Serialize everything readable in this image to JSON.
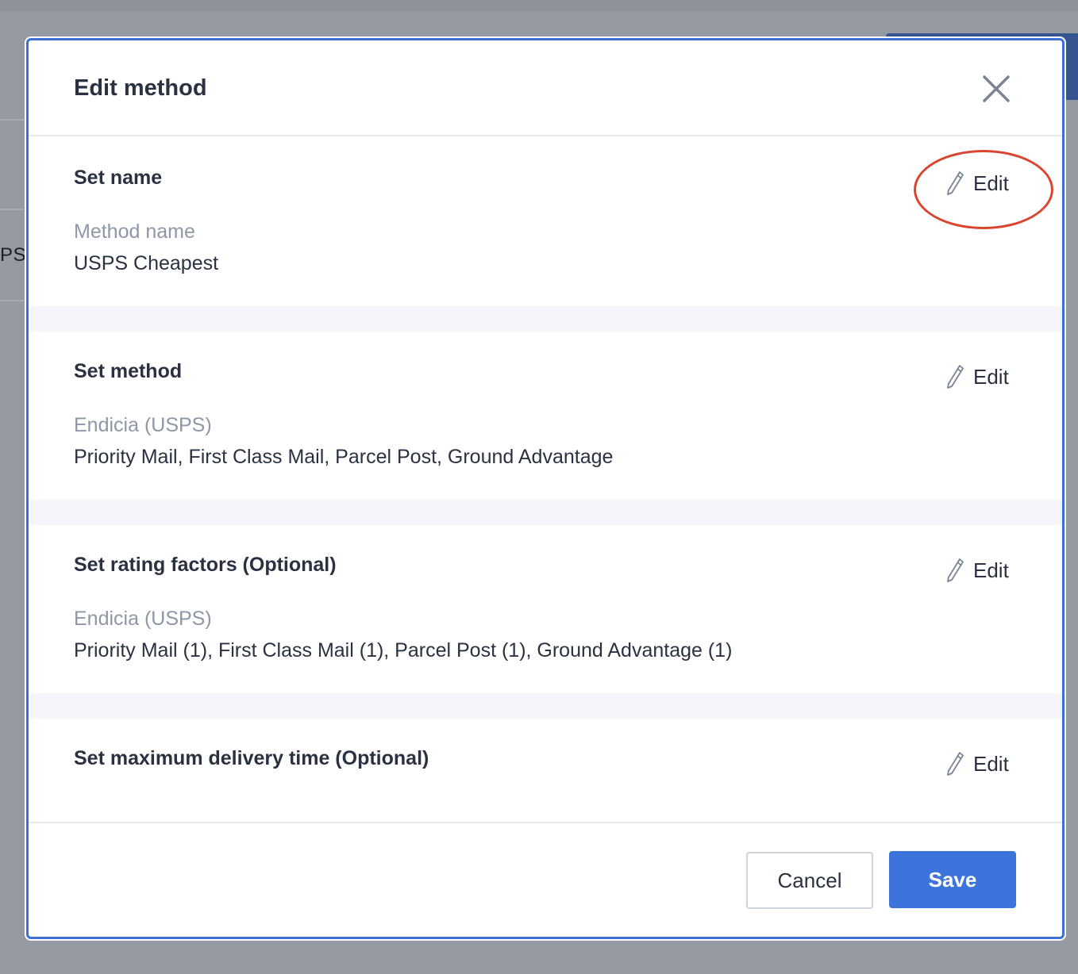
{
  "background": {
    "partial_text": "PS)"
  },
  "modal": {
    "title": "Edit method",
    "close_icon": "close-icon",
    "sections": [
      {
        "title": "Set name",
        "label": "Method name",
        "value": "USPS Cheapest",
        "edit_label": "Edit"
      },
      {
        "title": "Set method",
        "label": "Endicia (USPS)",
        "value": "Priority Mail, First Class Mail, Parcel Post, Ground Advantage",
        "edit_label": "Edit"
      },
      {
        "title": "Set rating factors (Optional)",
        "label": "Endicia (USPS)",
        "value": "Priority Mail (1), First Class Mail (1), Parcel Post (1), Ground Advantage (1)",
        "edit_label": "Edit"
      },
      {
        "title": "Set maximum delivery time (Optional)",
        "edit_label": "Edit"
      }
    ],
    "footer": {
      "cancel_label": "Cancel",
      "save_label": "Save"
    }
  },
  "colors": {
    "accent": "#3c74dc",
    "annotation": "#d9452e"
  }
}
